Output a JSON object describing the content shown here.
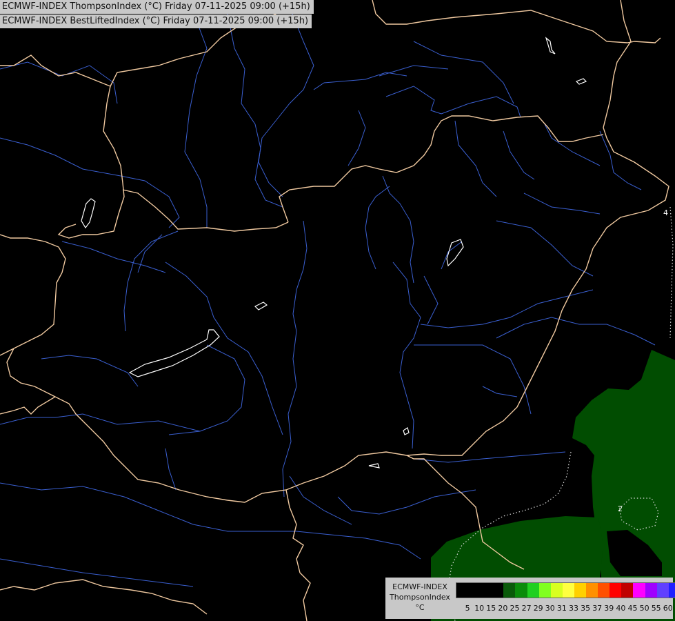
{
  "titles": {
    "line1": "ECMWF-INDEX ThompsonIndex (°C) Friday 07-11-2025 09:00 (+15h)",
    "line2": "ECMWF-INDEX BestLiftedIndex (°C) Friday 07-11-2025 09:00 (+15h)"
  },
  "contour_labels": [
    "2",
    "4"
  ],
  "legend": {
    "line1": "ECMWF-INDEX",
    "line2": "ThompsonIndex",
    "line3": "°C",
    "ticks": [
      "5",
      "10",
      "15",
      "20",
      "25",
      "27",
      "29",
      "30",
      "31",
      "33",
      "35",
      "37",
      "39",
      "40",
      "45",
      "50",
      "55",
      "60"
    ],
    "colors": [
      "#000000",
      "#000000",
      "#000000",
      "#000000",
      "#0a5a0a",
      "#0a8c0a",
      "#20d020",
      "#80ff20",
      "#d8ff20",
      "#ffff40",
      "#ffd000",
      "#ff9000",
      "#ff5000",
      "#ff0000",
      "#c00000",
      "#ff00ff",
      "#a000ff",
      "#6040ff",
      "#2020ff"
    ]
  },
  "map_colors": {
    "border": "#f0c9a0",
    "river": "#3a5fd0",
    "lake": "#ffffff",
    "field_low": "#014d01"
  }
}
